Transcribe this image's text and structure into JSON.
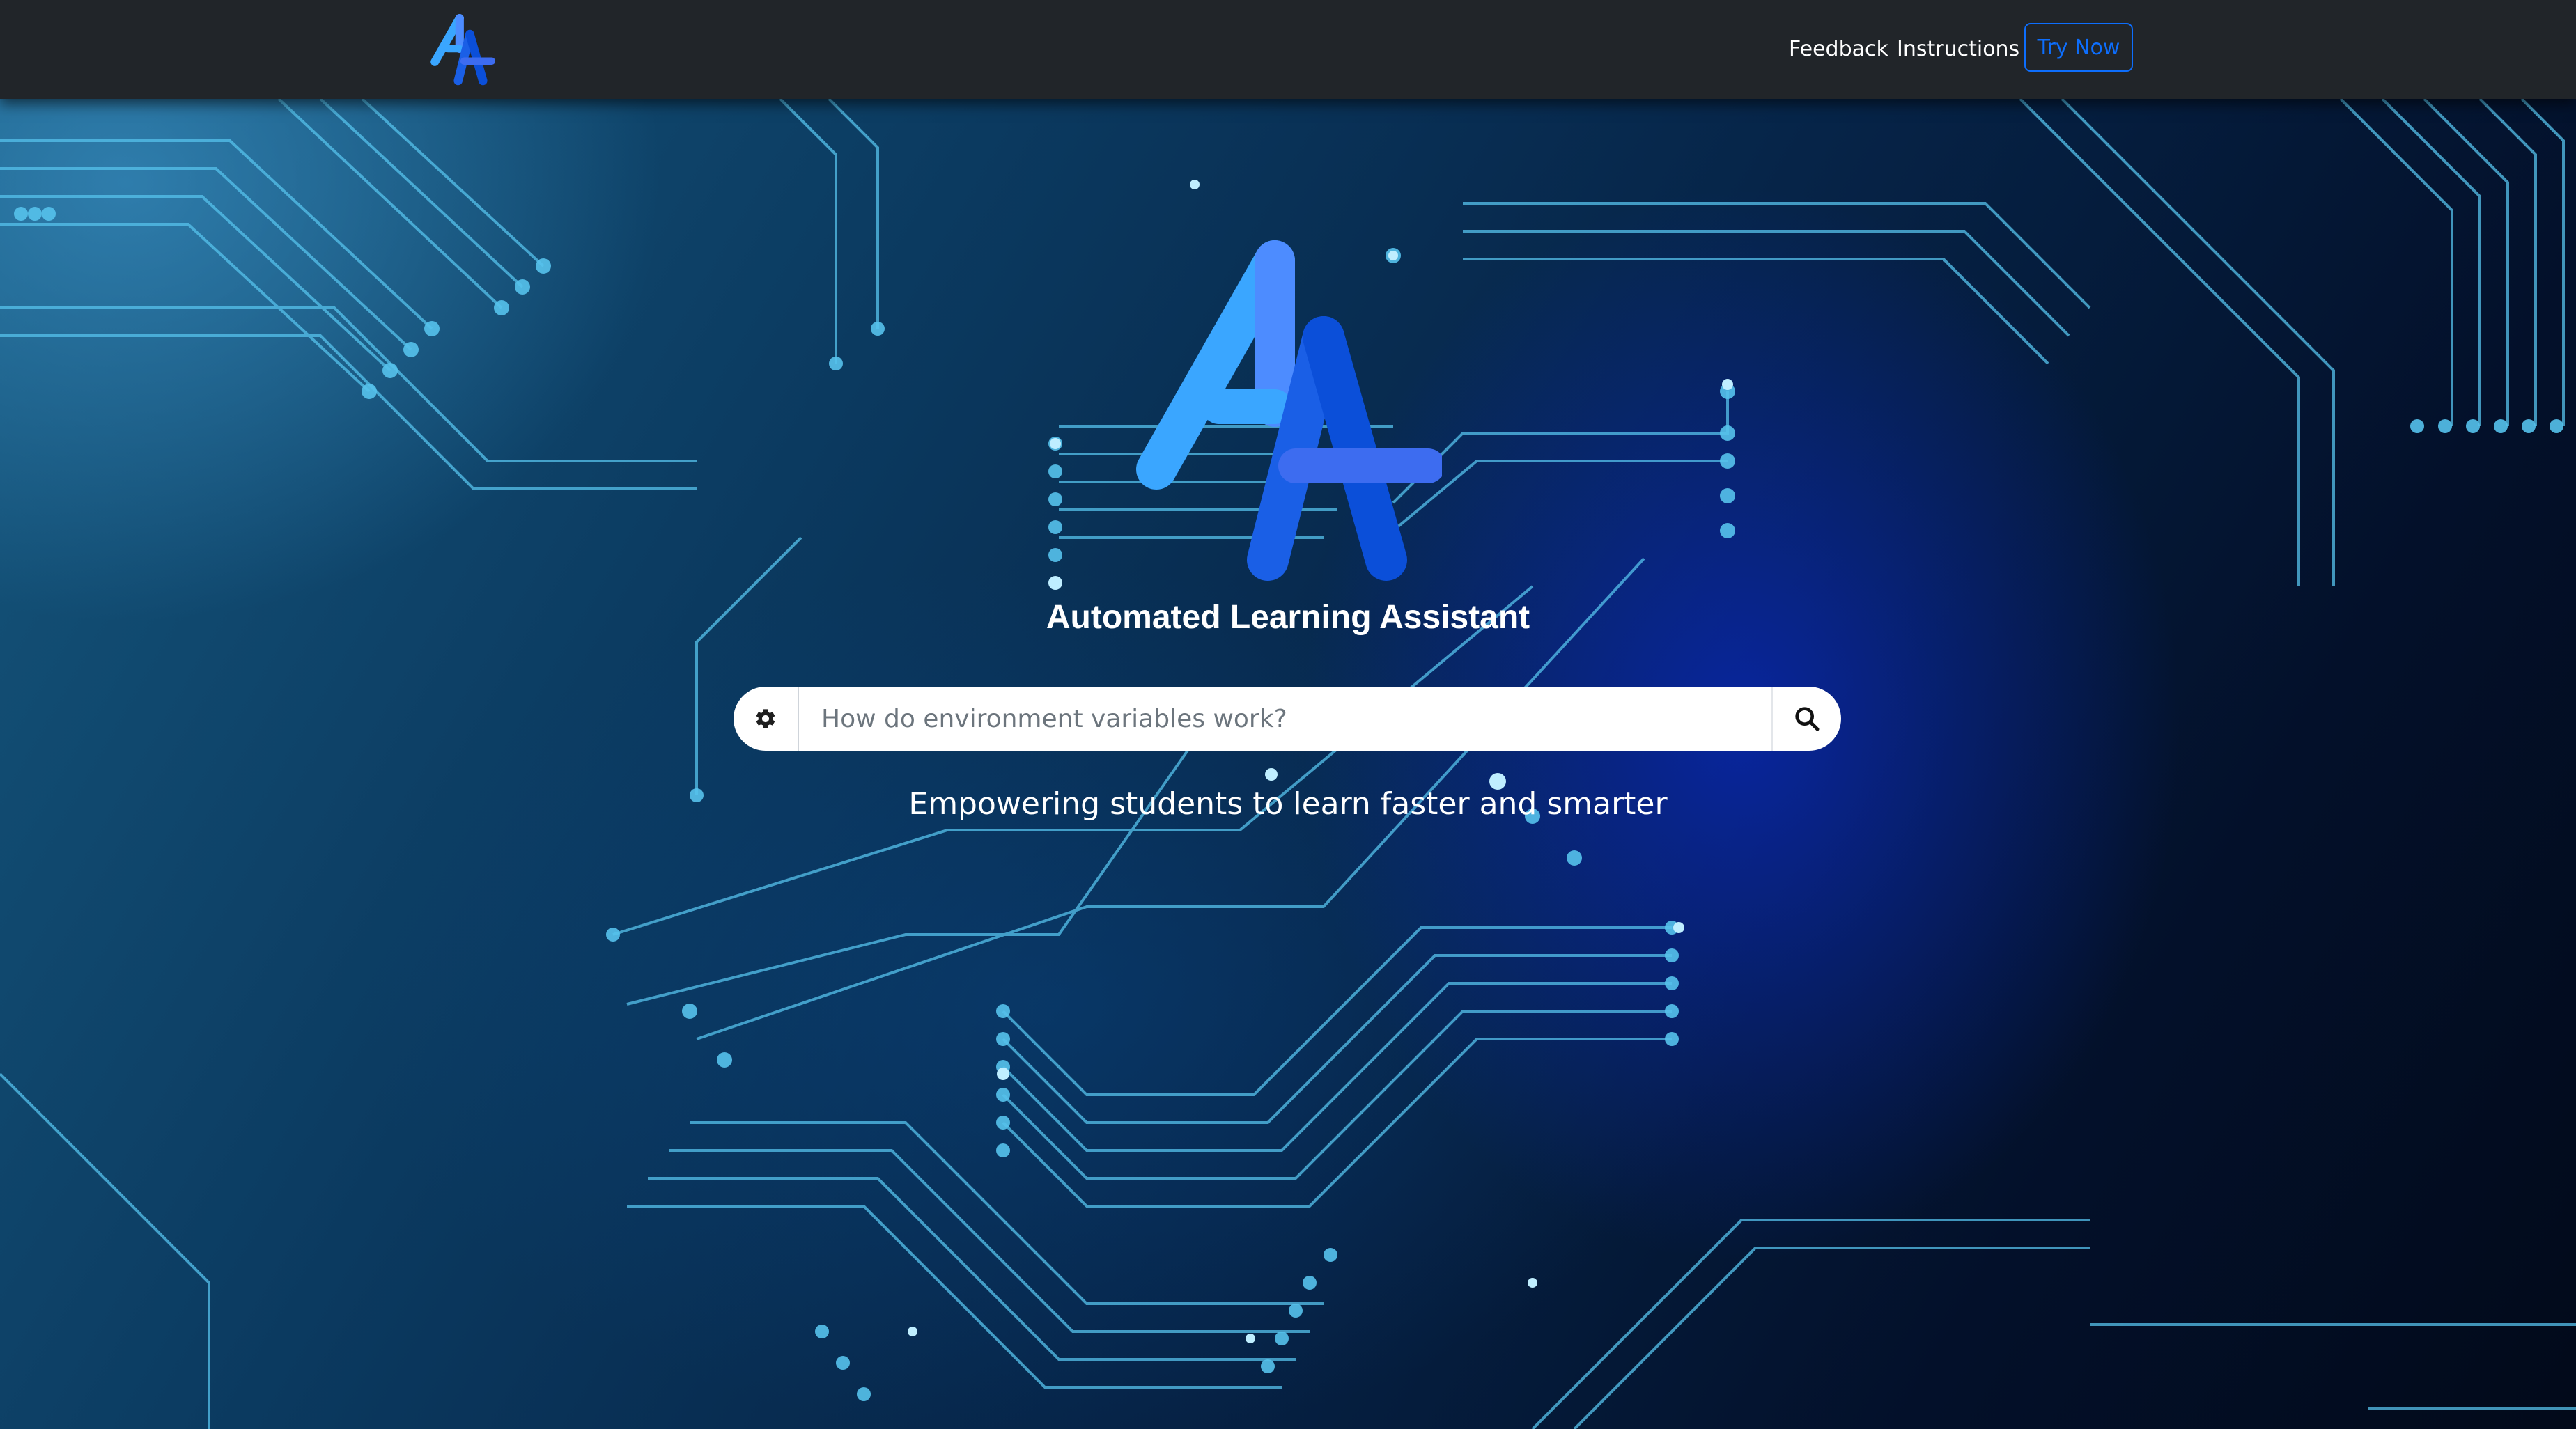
{
  "navbar": {
    "feedback_label": "Feedback",
    "instructions_label": "Instructions",
    "try_now_label": "Try Now"
  },
  "hero": {
    "title": "Automated Learning Assistant",
    "tagline": "Empowering students to learn faster and smarter"
  },
  "search": {
    "placeholder": "How do environment variables work?",
    "value": ""
  },
  "icons": {
    "logo": "aa-logo-icon",
    "settings": "gear-icon",
    "search": "search-icon"
  },
  "colors": {
    "navbar_bg": "#212529",
    "accent": "#0d6efd",
    "logo_light_blue": "#3aa6ff",
    "logo_dark_blue": "#0b4fd9"
  }
}
